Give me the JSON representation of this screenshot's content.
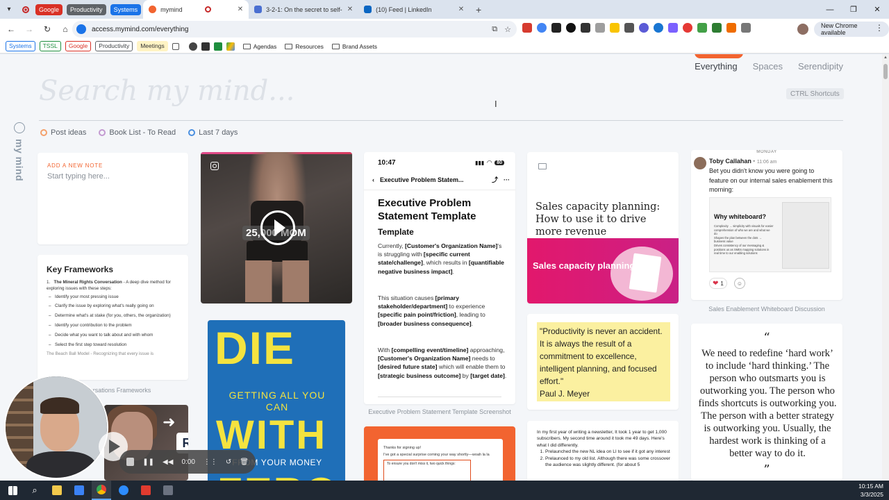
{
  "browser": {
    "tab_groups": [
      {
        "label": "Google",
        "color": "#d93025"
      },
      {
        "label": "Productivity",
        "color": "#5f6368"
      },
      {
        "label": "Systems",
        "color": "#1a73e8"
      }
    ],
    "tabs": [
      {
        "title": "mymind",
        "active": true
      },
      {
        "title": "3-2-1: On the secret to self-con",
        "active": false
      },
      {
        "title": "(10) Feed | LinkedIn",
        "active": false
      }
    ],
    "new_tab": "+",
    "url": "access.mymind.com/everything",
    "new_chrome": "New Chrome available",
    "bookmarks_chips": [
      {
        "label": "Systems",
        "color": "#1a73e8"
      },
      {
        "label": "TSSL",
        "color": "#1e8e3e"
      },
      {
        "label": "Google",
        "color": "#d93025"
      },
      {
        "label": "Productivity",
        "color": "#5f6368"
      },
      {
        "label": "Meetings",
        "color": "#f9ab00"
      }
    ],
    "bookmark_folders": [
      "Agendas",
      "Resources",
      "Brand Assets"
    ]
  },
  "app": {
    "brand": "my mind",
    "nav": {
      "everything": "Everything",
      "spaces": "Spaces",
      "serendipity": "Serendipity"
    },
    "search_placeholder": "Search my mind...",
    "shortcuts": "CTRL Shortcuts",
    "filters": [
      {
        "label": "Post ideas",
        "color": "#f4a06b"
      },
      {
        "label": "Book List - To Read",
        "color": "#c39ad1"
      },
      {
        "label": "Last 7 days",
        "color": "#4a8fe0"
      }
    ]
  },
  "cards": {
    "note": {
      "label": "ADD A NEW NOTE",
      "placeholder": "Start typing here..."
    },
    "frameworks": {
      "title": "Key Frameworks",
      "item1_title": "The Mineral Rights Conversation",
      "item1_desc": " - A deep dive method for exploring issues with these steps:",
      "steps": [
        "Identify your most pressing issue",
        "Clarify the issue by exploring what's really going on",
        "Determine what's at stake (for you, others, the organization)",
        "Identify your contribution to the problem",
        "Decide what you want to talk about and with whom",
        "Select the first step toward resolution"
      ],
      "item2": "The Beach Ball Model - Recognizing that every issue is",
      "caption": "Conversations Frameworks"
    },
    "video": {
      "overlay_text": "25,000 MOM"
    },
    "book": {
      "title_top": "DIE",
      "subtitle": "GETTING ALL YOU CAN",
      "title_mid": "WITH",
      "from": "FROM YOUR MONEY",
      "title_bottom": "ZERO"
    },
    "template": {
      "time": "10:47",
      "battery": "80",
      "nav_title": "Executive Problem Statem...",
      "title": "Executive Problem Statement Template",
      "subtitle": "Template",
      "p1_a": "Currently, ",
      "p1_b": "[Customer's Organization Name]",
      "p1_c": "'s is struggling with ",
      "p1_d": "[specific current state/challenge]",
      "p1_e": ", which results in ",
      "p1_f": "[quantifiable negative business impact]",
      "p1_g": ".",
      "p2_a": "This situation causes ",
      "p2_b": "[primary stakeholder/department]",
      "p2_c": " to experience ",
      "p2_d": "[specific pain point/friction]",
      "p2_e": ", leading to ",
      "p2_f": "[broader business consequence]",
      "p2_g": ".",
      "p3_a": "With ",
      "p3_b": "[compelling event/timeline]",
      "p3_c": " approaching, ",
      "p3_d": "[Customer's Organization Name]",
      "p3_e": " needs to ",
      "p3_f": "[desired future state]",
      "p3_g": " which will enable them to ",
      "p3_h": "[strategic business outcome]",
      "p3_i": " by ",
      "p3_j": "[target date]",
      "p3_k": ".",
      "caption": "Executive Problem Statement Template Screenshot"
    },
    "signup": {
      "line1": "Thanks for signing up!",
      "line2": "I've got a special surprise coming your way shortly—woah la la",
      "box": "To ensure you don't miss it, two quick things:"
    },
    "sales": {
      "title": "Sales capacity planning: How to use it to drive more revenue",
      "banner": "Sales capacity planning"
    },
    "quote": {
      "text": "\"Productivity is never an accident. It is always the result of a commitment to excellence, intelligent planning, and focused effort.\"",
      "author": "Paul J. Meyer"
    },
    "newsletter": {
      "intro": "In my first year of writing a newsletter, It took 1 year to get 1,000 subscribers. My second time around it took me 49 days. Here's what I did differently.",
      "items": [
        "Prelaunched the new NL idea on LI to see if it got any interest",
        "Prelaunced to my old list. Although there was some crossover the audience was slightly different. (for about 5"
      ]
    },
    "linkedin": {
      "day": "MONDAY",
      "name": "Toby Callahan",
      "time": "11:06 am",
      "message": "Bet you didn't know you were going to feature on our internal sales enablement this morning:",
      "image_title": "Why whiteboard?",
      "image_lines": [
        "Complexity → simplicity with visuals for easier comprehension of who we are and what we do",
        "Shapes the plan between the dots → business value",
        "Drives consistency of our messaging & positions us as SMEs mapping solutions in real time to our enabling solutions"
      ],
      "reaction_count": "1",
      "caption": "Sales Enablement Whiteboard Discussion"
    },
    "hardwork": {
      "open": "“",
      "text": "We need to redefine ‘hard work’ to include ‘hard thinking.’ The person who outsmarts you is outworking you. The person who finds shortcuts is outworking you. The person with a better strategy is outworking you. Usually, the hardest work is thinking of a better way to do it.",
      "close": "”"
    },
    "mini_video": {
      "badge": "R"
    }
  },
  "recorder": {
    "time": "0:00"
  },
  "taskbar": {
    "time": "10:15 AM",
    "date": "3/3/2025"
  }
}
